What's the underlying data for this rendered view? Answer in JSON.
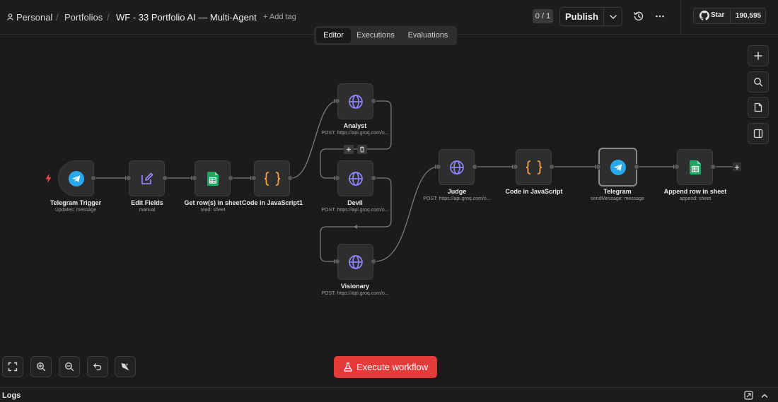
{
  "breadcrumb": {
    "workspace": "Personal",
    "separator": "/",
    "project": "Portfolios",
    "workflow_title": "WF - 33 Portfolio AI — Multi-Agent",
    "add_tag": "+ Add tag"
  },
  "header": {
    "counter": "0 / 1",
    "publish_label": "Publish",
    "github_star_label": "Star",
    "github_star_count": "190,595"
  },
  "tabs": [
    {
      "label": "Editor",
      "active": true
    },
    {
      "label": "Executions",
      "active": false
    },
    {
      "label": "Evaluations",
      "active": false
    }
  ],
  "nodes": {
    "telegram_trigger": {
      "label": "Telegram Trigger",
      "subtitle": "Updates: message",
      "icon": "telegram-icon"
    },
    "edit_fields": {
      "label": "Edit Fields",
      "subtitle": "manual",
      "icon": "pencil-icon"
    },
    "get_rows": {
      "label": "Get row(s) in sheet",
      "subtitle": "read: sheet",
      "icon": "google-sheets-icon"
    },
    "code1": {
      "label": "Code in JavaScript1",
      "subtitle": "",
      "icon": "code-braces-icon"
    },
    "analyst": {
      "label": "Analyst",
      "subtitle": "POST: https://api.groq.com/o...",
      "icon": "globe-icon"
    },
    "devil": {
      "label": "Devil",
      "subtitle": "POST: https://api.groq.com/o...",
      "icon": "globe-icon"
    },
    "visionary": {
      "label": "Visionary",
      "subtitle": "POST: https://api.groq.com/o...",
      "icon": "globe-icon"
    },
    "judge": {
      "label": "Judge",
      "subtitle": "POST: https://api.groq.com/o...",
      "icon": "globe-icon"
    },
    "code2": {
      "label": "Code in JavaScript",
      "subtitle": "",
      "icon": "code-braces-icon"
    },
    "telegram": {
      "label": "Telegram",
      "subtitle": "sendMessage: message",
      "icon": "telegram-icon"
    },
    "append_row": {
      "label": "Append row in sheet",
      "subtitle": "append: sheet",
      "icon": "google-sheets-icon"
    }
  },
  "execute_button": {
    "label": "Execute workflow",
    "icon": "flask-icon"
  },
  "logs": {
    "label": "Logs"
  },
  "colors": {
    "canvas": "#1b1b1c",
    "node_bg": "#2e2e2f",
    "accent_red": "#e43b3b",
    "globe_purple": "#8c85ff",
    "telegram_blue": "#29a9eb",
    "sheets_green": "#21a464",
    "code_orange": "#f0a14a"
  }
}
